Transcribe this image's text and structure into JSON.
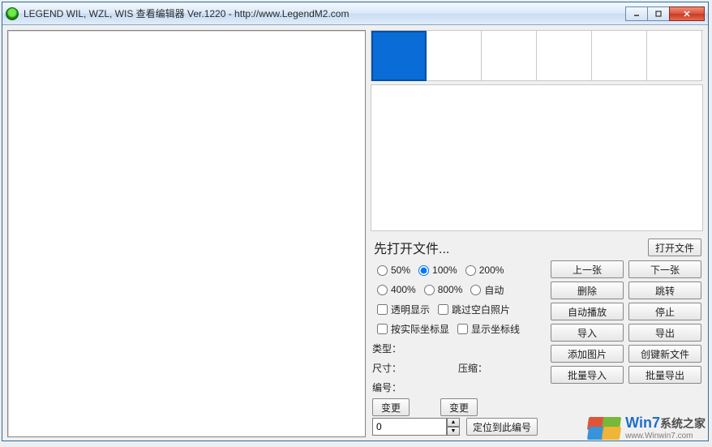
{
  "titlebar": {
    "title": "LEGEND WIL, WZL, WIS 查看编辑器 Ver.1220   - http://www.LegendM2.com"
  },
  "thumbnails": {
    "count": 6,
    "selected_index": 0
  },
  "controls": {
    "open_prompt": "先打开文件...",
    "open_btn": "打开文件",
    "zoom": {
      "z50": "50%",
      "z100": "100%",
      "z200": "200%",
      "z400": "400%",
      "z800": "800%",
      "zauto": "自动",
      "selected": "z100"
    },
    "checks": {
      "transparent": "透明显示",
      "skip_blank": "跳过空白照片",
      "real_coord": "按实际坐标显",
      "show_grid": "显示坐标线"
    },
    "labels": {
      "type": "类型：",
      "size": "尺寸：",
      "compress": "压缩：",
      "index": "编号："
    },
    "change_btn": "变更",
    "spinner_value": "0",
    "locate_btn": "定位到此编号",
    "buttons": {
      "prev": "上一张",
      "next": "下一张",
      "delete": "删除",
      "jump": "跳转",
      "autoplay": "自动播放",
      "stop": "停止",
      "import": "导入",
      "export": "导出",
      "add_img": "添加图片",
      "new_file": "创键新文件",
      "batch_in": "批量导入",
      "batch_out": "批量导出"
    }
  },
  "watermark": {
    "brand_a": "Win7",
    "brand_b": "系统之家",
    "url": "www.Winwin7.com"
  }
}
